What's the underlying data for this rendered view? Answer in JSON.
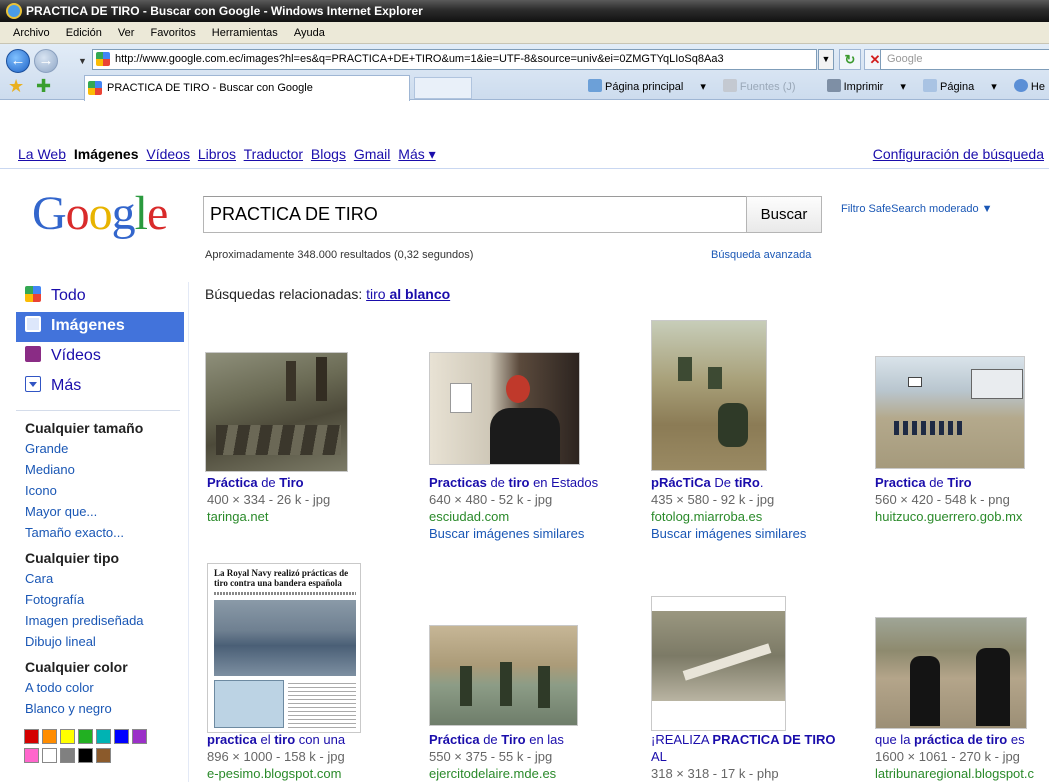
{
  "window": {
    "title": "PRACTICA DE TIRO - Buscar con Google - Windows Internet Explorer"
  },
  "menu": [
    "Archivo",
    "Edición",
    "Ver",
    "Favoritos",
    "Herramientas",
    "Ayuda"
  ],
  "address": {
    "url": "http://www.google.com.ec/images?hl=es&q=PRACTICA+DE+TIRO&um=1&ie=UTF-8&source=univ&ei=0ZMGTYqLIoSq8Aa3",
    "search_placeholder": "Google"
  },
  "tab": {
    "title": "PRACTICA DE TIRO - Buscar con Google"
  },
  "commandbar": {
    "home": "Página principal",
    "feeds": "Fuentes (J)",
    "print": "Imprimir",
    "page": "Página",
    "help": "He"
  },
  "google_nav": {
    "links": [
      "La Web",
      "Imágenes",
      "Vídeos",
      "Libros",
      "Traductor",
      "Blogs",
      "Gmail",
      "Más ▾"
    ],
    "settings": "Configuración de búsqueda"
  },
  "logo": {
    "text": "Google"
  },
  "search": {
    "query": "PRACTICA DE TIRO",
    "button": "Buscar",
    "safesearch": "Filtro SafeSearch moderado ▼",
    "stats": "Aproximadamente 348.000 resultados (0,32 segundos)",
    "advanced": "Búsqueda avanzada"
  },
  "sidebar": {
    "items": [
      {
        "label": "Todo"
      },
      {
        "label": "Imágenes"
      },
      {
        "label": "Vídeos"
      },
      {
        "label": "Más"
      }
    ],
    "size_heading": "Cualquier tamaño",
    "size_links": [
      "Grande",
      "Mediano",
      "Icono",
      "Mayor que...",
      "Tamaño exacto..."
    ],
    "type_heading": "Cualquier tipo",
    "type_links": [
      "Cara",
      "Fotografía",
      "Imagen prediseñada",
      "Dibujo lineal"
    ],
    "color_heading": "Cualquier color",
    "color_links": [
      "A todo color",
      "Blanco y negro"
    ],
    "swatches": [
      "#d40000",
      "#ff8c00",
      "#ffff00",
      "#22b022",
      "#00b3b3",
      "#0000ff",
      "#9b30c8",
      "#ff66cc",
      "#ffffff",
      "#808080",
      "#000000",
      "#8b5a2b"
    ]
  },
  "related": {
    "prefix": "Búsquedas relacionadas:",
    "link_plain": "tiro",
    "link_bold": "al blanco"
  },
  "results": [
    {
      "t1": "Práctica",
      "t2": " de ",
      "t3": "Tiro",
      "meta": "400 × 334 - 26 k - jpg",
      "site": "taringa.net",
      "similar": ""
    },
    {
      "t1": "Practicas",
      "t2": " de ",
      "t3": "tiro",
      "t4": " en Estados",
      "meta": "640 × 480 - 52 k - jpg",
      "site": "esciudad.com",
      "similar": "Buscar imágenes similares"
    },
    {
      "t1": "pRácTiCa",
      "t2": " De ",
      "t3": "tiRo",
      "t4": ".",
      "meta": "435 × 580 - 92 k - jpg",
      "site": "fotolog.miarroba.es",
      "similar": "Buscar imágenes similares"
    },
    {
      "t1": "Practica",
      "t2": " de ",
      "t3": "Tiro",
      "meta": "560 × 420 - 548 k - png",
      "site": "huitzuco.guerrero.gob.mx",
      "similar": ""
    },
    {
      "t1": "practica",
      "t2": " el ",
      "t3": "tiro",
      "t4": " con una",
      "meta": "896 × 1000 - 158 k - jpg",
      "site": "e-pesimo.blogspot.com",
      "similar": "",
      "img_headline": "La Royal Navy realizó prácticas de tiro contra una bandera española"
    },
    {
      "t1": "Práctica",
      "t2": " de ",
      "t3": "Tiro",
      "t4": " en las",
      "meta": "550 × 375 - 55 k - jpg",
      "site": "ejercitodelaire.mde.es",
      "similar": ""
    },
    {
      "t1": "¡REALIZA ",
      "t2": "",
      "t3": "PRACTICA DE TIRO",
      "t4": "",
      "t5": "AL",
      "meta": "318 × 318 - 17 k - php",
      "site": "",
      "similar": ""
    },
    {
      "t1": "que la ",
      "t2": "",
      "t3": "práctica de tiro",
      "t4": " es",
      "meta": "1600 × 1061 - 270 k - jpg",
      "site": "latribunaregional.blogspot.c",
      "similar": ""
    }
  ]
}
